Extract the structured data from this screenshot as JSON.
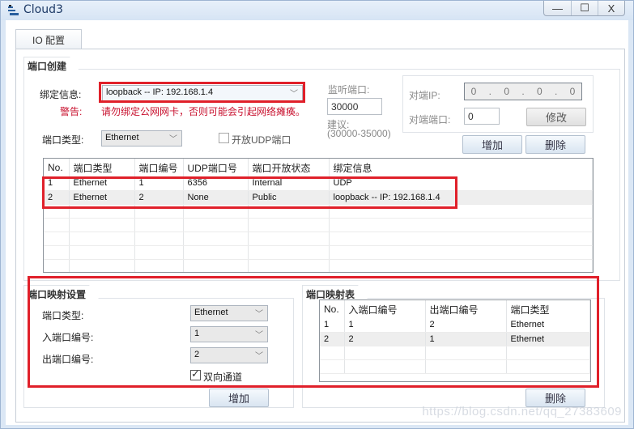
{
  "window": {
    "title": "Cloud3",
    "controls": {
      "minimize": "—",
      "maximize": "☐",
      "close": "X"
    }
  },
  "tabs": [
    {
      "label": "IO 配置",
      "active": true
    }
  ],
  "port_creation": {
    "title": "端口创建",
    "binding_label": "绑定信息:",
    "binding_value": "loopback -- IP: 192.168.1.4",
    "warning_label": "警告:",
    "warning_text": "请勿绑定公网网卡，否则可能会引起网络瘫痪。",
    "port_type_label": "端口类型:",
    "port_type_value": "Ethernet",
    "open_udp_label": "开放UDP端口",
    "open_udp_checked": false,
    "listen_port_label": "监听端口:",
    "listen_port_value": "30000",
    "suggest_label": "建议:",
    "suggest_range": "(30000-35000)",
    "peer_ip_label": "对端IP:",
    "peer_ip_octets": [
      "0",
      "0",
      "0",
      "0"
    ],
    "peer_port_label": "对端端口:",
    "peer_port_value": "0",
    "modify_button": "修改",
    "add_button": "增加",
    "delete_button": "删除",
    "table": {
      "columns": [
        "No.",
        "端口类型",
        "端口编号",
        "UDP端口号",
        "端口开放状态",
        "绑定信息"
      ],
      "rows": [
        [
          "1",
          "Ethernet",
          "1",
          "6356",
          "Internal",
          "UDP"
        ],
        [
          "2",
          "Ethernet",
          "2",
          "None",
          "Public",
          "loopback -- IP: 192.168.1.4"
        ]
      ]
    }
  },
  "port_mapping_settings": {
    "title": "端口映射设置",
    "port_type_label": "端口类型:",
    "port_type_value": "Ethernet",
    "in_port_label": "入端口编号:",
    "in_port_value": "1",
    "out_port_label": "出端口编号:",
    "out_port_value": "2",
    "bidirectional_label": "双向通道",
    "bidirectional_checked": true,
    "add_button": "增加"
  },
  "port_mapping_table": {
    "title": "端口映射表",
    "columns": [
      "No.",
      "入端口编号",
      "出端口编号",
      "端口类型"
    ],
    "rows": [
      [
        "1",
        "1",
        "2",
        "Ethernet"
      ],
      [
        "2",
        "2",
        "1",
        "Ethernet"
      ]
    ],
    "delete_button": "删除"
  },
  "watermark": "https://blog.csdn.net/qq_27383609",
  "colors": {
    "highlight_border": "#e0202a",
    "warning_text": "#c8102e",
    "title_text": "#1e3a66"
  }
}
